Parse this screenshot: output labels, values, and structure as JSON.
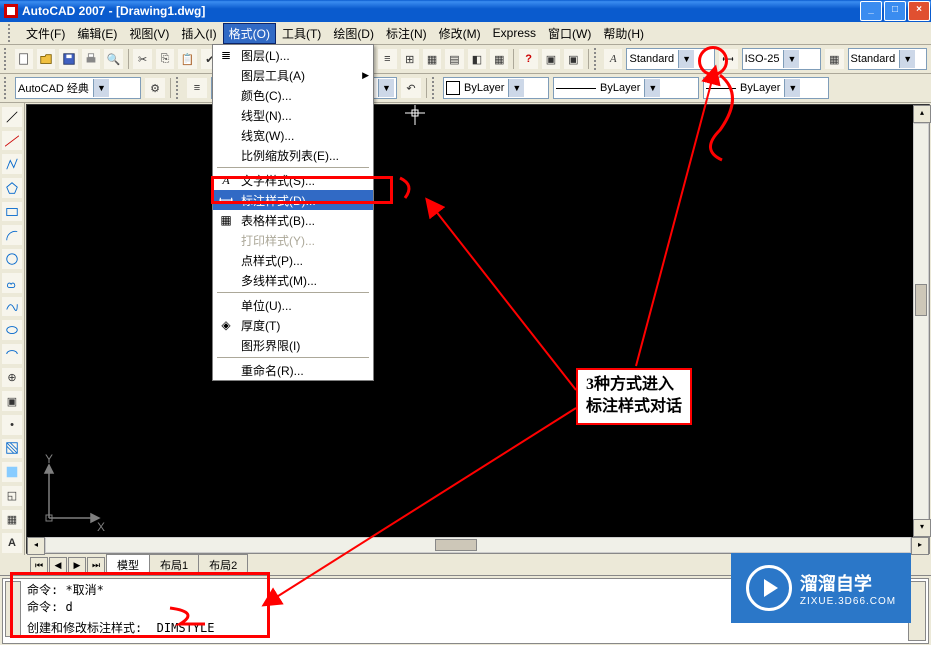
{
  "title": "AutoCAD 2007 - [Drawing1.dwg]",
  "menus": {
    "file": "文件(F)",
    "edit": "编辑(E)",
    "view": "视图(V)",
    "insert": "插入(I)",
    "format": "格式(O)",
    "tools": "工具(T)",
    "draw": "绘图(D)",
    "dimension": "标注(N)",
    "modify": "修改(M)",
    "express": "Express",
    "window": "窗口(W)",
    "help": "帮助(H)"
  },
  "workspace_combo": "AutoCAD 经典",
  "style_combo1": "Standard",
  "style_combo2": "ISO-25",
  "style_combo3": "Standard",
  "layer_combo": "",
  "bylayer1": "ByLayer",
  "bylayer2": "ByLayer",
  "bylayer3": "ByLayer",
  "format_menu": {
    "layer": "图层(L)...",
    "layer_tools": "图层工具(A)",
    "color": "颜色(C)...",
    "linetype": "线型(N)...",
    "lineweight": "线宽(W)...",
    "scale_list": "比例缩放列表(E)...",
    "text_style": "文字样式(S)...",
    "dim_style": "标注样式(D)...",
    "table_style": "表格样式(B)...",
    "plot_style": "打印样式(Y)...",
    "point_style": "点样式(P)...",
    "mline_style": "多线样式(M)...",
    "units": "单位(U)...",
    "thickness": "厚度(T)",
    "limits": "图形界限(I)",
    "rename": "重命名(R)..."
  },
  "tabs": {
    "model": "模型",
    "layout1": "布局1",
    "layout2": "布局2"
  },
  "cmd": {
    "line1": "命令: *取消*",
    "line2": "命令: d",
    "hint": "创建和修改标注样式:  DIMSTYLE"
  },
  "ucs": {
    "y": "Y",
    "x": "X"
  },
  "annotation": {
    "line1": "3种方式进入",
    "line2": "标注样式对话"
  },
  "watermark": {
    "brand": "溜溜自学",
    "url": "ZIXUE.3D66.COM"
  }
}
